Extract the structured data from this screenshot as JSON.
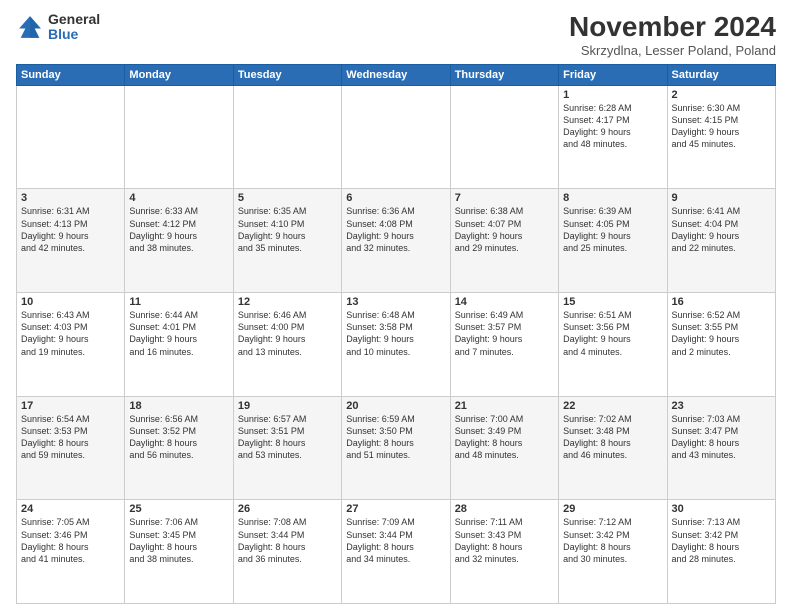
{
  "logo": {
    "general": "General",
    "blue": "Blue"
  },
  "title": "November 2024",
  "location": "Skrzydlna, Lesser Poland, Poland",
  "days_header": [
    "Sunday",
    "Monday",
    "Tuesday",
    "Wednesday",
    "Thursday",
    "Friday",
    "Saturday"
  ],
  "weeks": [
    [
      {
        "day": "",
        "info": ""
      },
      {
        "day": "",
        "info": ""
      },
      {
        "day": "",
        "info": ""
      },
      {
        "day": "",
        "info": ""
      },
      {
        "day": "",
        "info": ""
      },
      {
        "day": "1",
        "info": "Sunrise: 6:28 AM\nSunset: 4:17 PM\nDaylight: 9 hours\nand 48 minutes."
      },
      {
        "day": "2",
        "info": "Sunrise: 6:30 AM\nSunset: 4:15 PM\nDaylight: 9 hours\nand 45 minutes."
      }
    ],
    [
      {
        "day": "3",
        "info": "Sunrise: 6:31 AM\nSunset: 4:13 PM\nDaylight: 9 hours\nand 42 minutes."
      },
      {
        "day": "4",
        "info": "Sunrise: 6:33 AM\nSunset: 4:12 PM\nDaylight: 9 hours\nand 38 minutes."
      },
      {
        "day": "5",
        "info": "Sunrise: 6:35 AM\nSunset: 4:10 PM\nDaylight: 9 hours\nand 35 minutes."
      },
      {
        "day": "6",
        "info": "Sunrise: 6:36 AM\nSunset: 4:08 PM\nDaylight: 9 hours\nand 32 minutes."
      },
      {
        "day": "7",
        "info": "Sunrise: 6:38 AM\nSunset: 4:07 PM\nDaylight: 9 hours\nand 29 minutes."
      },
      {
        "day": "8",
        "info": "Sunrise: 6:39 AM\nSunset: 4:05 PM\nDaylight: 9 hours\nand 25 minutes."
      },
      {
        "day": "9",
        "info": "Sunrise: 6:41 AM\nSunset: 4:04 PM\nDaylight: 9 hours\nand 22 minutes."
      }
    ],
    [
      {
        "day": "10",
        "info": "Sunrise: 6:43 AM\nSunset: 4:03 PM\nDaylight: 9 hours\nand 19 minutes."
      },
      {
        "day": "11",
        "info": "Sunrise: 6:44 AM\nSunset: 4:01 PM\nDaylight: 9 hours\nand 16 minutes."
      },
      {
        "day": "12",
        "info": "Sunrise: 6:46 AM\nSunset: 4:00 PM\nDaylight: 9 hours\nand 13 minutes."
      },
      {
        "day": "13",
        "info": "Sunrise: 6:48 AM\nSunset: 3:58 PM\nDaylight: 9 hours\nand 10 minutes."
      },
      {
        "day": "14",
        "info": "Sunrise: 6:49 AM\nSunset: 3:57 PM\nDaylight: 9 hours\nand 7 minutes."
      },
      {
        "day": "15",
        "info": "Sunrise: 6:51 AM\nSunset: 3:56 PM\nDaylight: 9 hours\nand 4 minutes."
      },
      {
        "day": "16",
        "info": "Sunrise: 6:52 AM\nSunset: 3:55 PM\nDaylight: 9 hours\nand 2 minutes."
      }
    ],
    [
      {
        "day": "17",
        "info": "Sunrise: 6:54 AM\nSunset: 3:53 PM\nDaylight: 8 hours\nand 59 minutes."
      },
      {
        "day": "18",
        "info": "Sunrise: 6:56 AM\nSunset: 3:52 PM\nDaylight: 8 hours\nand 56 minutes."
      },
      {
        "day": "19",
        "info": "Sunrise: 6:57 AM\nSunset: 3:51 PM\nDaylight: 8 hours\nand 53 minutes."
      },
      {
        "day": "20",
        "info": "Sunrise: 6:59 AM\nSunset: 3:50 PM\nDaylight: 8 hours\nand 51 minutes."
      },
      {
        "day": "21",
        "info": "Sunrise: 7:00 AM\nSunset: 3:49 PM\nDaylight: 8 hours\nand 48 minutes."
      },
      {
        "day": "22",
        "info": "Sunrise: 7:02 AM\nSunset: 3:48 PM\nDaylight: 8 hours\nand 46 minutes."
      },
      {
        "day": "23",
        "info": "Sunrise: 7:03 AM\nSunset: 3:47 PM\nDaylight: 8 hours\nand 43 minutes."
      }
    ],
    [
      {
        "day": "24",
        "info": "Sunrise: 7:05 AM\nSunset: 3:46 PM\nDaylight: 8 hours\nand 41 minutes."
      },
      {
        "day": "25",
        "info": "Sunrise: 7:06 AM\nSunset: 3:45 PM\nDaylight: 8 hours\nand 38 minutes."
      },
      {
        "day": "26",
        "info": "Sunrise: 7:08 AM\nSunset: 3:44 PM\nDaylight: 8 hours\nand 36 minutes."
      },
      {
        "day": "27",
        "info": "Sunrise: 7:09 AM\nSunset: 3:44 PM\nDaylight: 8 hours\nand 34 minutes."
      },
      {
        "day": "28",
        "info": "Sunrise: 7:11 AM\nSunset: 3:43 PM\nDaylight: 8 hours\nand 32 minutes."
      },
      {
        "day": "29",
        "info": "Sunrise: 7:12 AM\nSunset: 3:42 PM\nDaylight: 8 hours\nand 30 minutes."
      },
      {
        "day": "30",
        "info": "Sunrise: 7:13 AM\nSunset: 3:42 PM\nDaylight: 8 hours\nand 28 minutes."
      }
    ]
  ]
}
